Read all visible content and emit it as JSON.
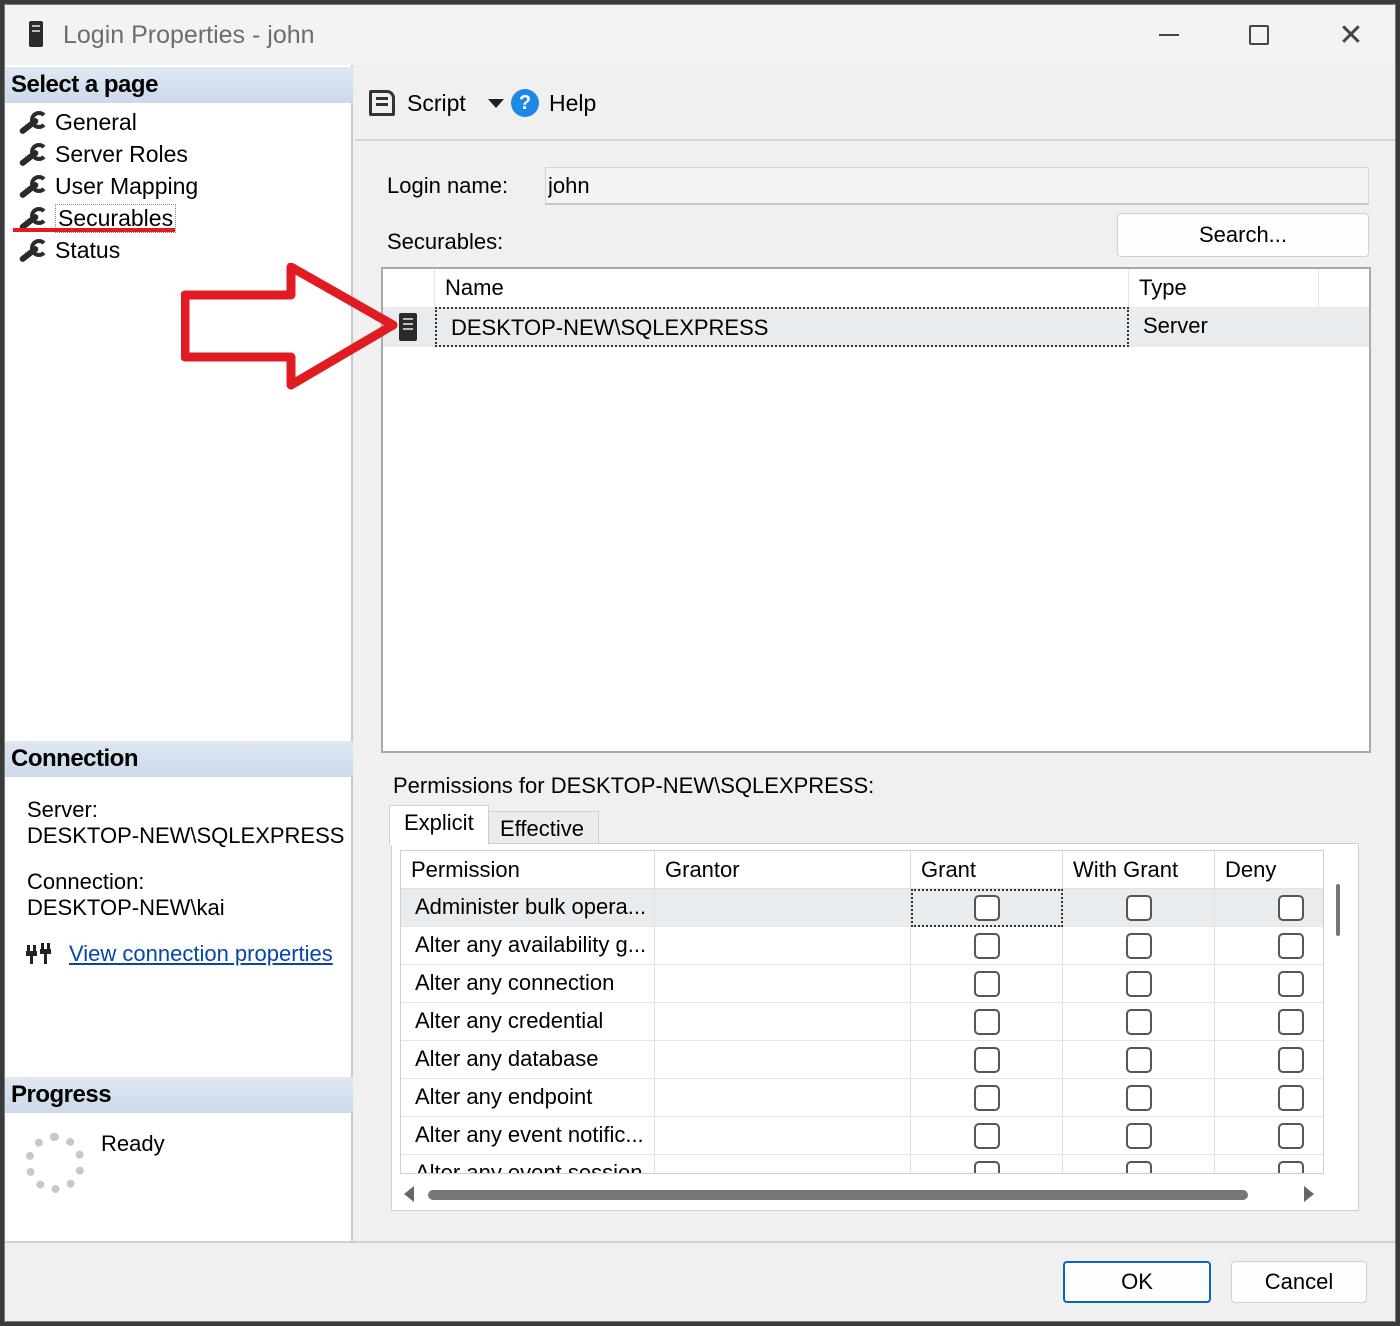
{
  "window": {
    "title": "Login Properties - john"
  },
  "left_pane": {
    "select_page_header": "Select a page",
    "nav_items": [
      {
        "label": "General"
      },
      {
        "label": "Server Roles"
      },
      {
        "label": "User Mapping"
      },
      {
        "label": "Securables",
        "selected": true
      },
      {
        "label": "Status"
      }
    ],
    "connection_header": "Connection",
    "server_label": "Server:",
    "server_value": "DESKTOP-NEW\\SQLEXPRESS",
    "connection_label": "Connection:",
    "connection_value": "DESKTOP-NEW\\kai",
    "view_connection_link": "View connection properties",
    "progress_header": "Progress",
    "progress_status": "Ready"
  },
  "toolbar": {
    "script_label": "Script",
    "help_label": "Help"
  },
  "form": {
    "login_name_label": "Login name:",
    "login_name_value": "john",
    "securables_label": "Securables:",
    "search_button": "Search..."
  },
  "securables_grid": {
    "columns": [
      "Name",
      "Type"
    ],
    "rows": [
      {
        "name": "DESKTOP-NEW\\SQLEXPRESS",
        "type": "Server"
      }
    ]
  },
  "permissions": {
    "label": "Permissions for DESKTOP-NEW\\SQLEXPRESS:",
    "tabs": [
      "Explicit",
      "Effective"
    ],
    "active_tab": "Explicit",
    "columns": [
      "Permission",
      "Grantor",
      "Grant",
      "With Grant",
      "Deny"
    ],
    "rows": [
      {
        "permission": "Administer bulk opera...",
        "grantor": "",
        "grant": false,
        "with_grant": false,
        "deny": false
      },
      {
        "permission": "Alter any availability g...",
        "grantor": "",
        "grant": false,
        "with_grant": false,
        "deny": false
      },
      {
        "permission": "Alter any connection",
        "grantor": "",
        "grant": false,
        "with_grant": false,
        "deny": false
      },
      {
        "permission": "Alter any credential",
        "grantor": "",
        "grant": false,
        "with_grant": false,
        "deny": false
      },
      {
        "permission": "Alter any database",
        "grantor": "",
        "grant": false,
        "with_grant": false,
        "deny": false
      },
      {
        "permission": "Alter any endpoint",
        "grantor": "",
        "grant": false,
        "with_grant": false,
        "deny": false
      },
      {
        "permission": "Alter any event notific...",
        "grantor": "",
        "grant": false,
        "with_grant": false,
        "deny": false
      },
      {
        "permission": "Alter any event session",
        "grantor": "",
        "grant": false,
        "with_grant": false,
        "deny": false
      }
    ]
  },
  "footer": {
    "ok_button": "OK",
    "cancel_button": "Cancel"
  },
  "colors": {
    "annotation_red": "#e01b22",
    "link_blue": "#0645ad",
    "ok_border": "#0a64c6"
  }
}
